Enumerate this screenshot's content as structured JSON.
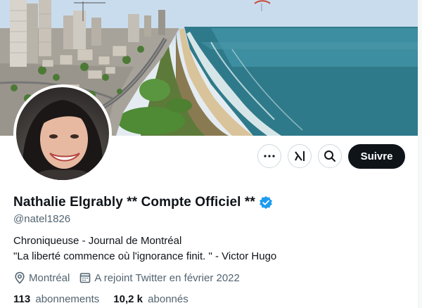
{
  "profile": {
    "display_name": "Nathalie Elgrably ** Compte Officiel **",
    "handle": "@natel1826",
    "bio_lines": [
      "Chroniqueuse - Journal de Montréal",
      "\"La liberté commence où l'ignorance finit. \" - Victor Hugo"
    ],
    "location": "Montréal",
    "joined": "A rejoint Twitter en février 2022",
    "following_count": "113",
    "following_label": "abonnements",
    "followers_count": "10,2 k",
    "followers_label": "abonnés",
    "verified": true
  },
  "actions": {
    "more_icon": "more-horizontal-icon",
    "grok_icon": "grok-icon",
    "search_icon": "search-icon",
    "follow_label": "Suivre"
  },
  "icons": {
    "location": "location-pin-icon",
    "calendar": "calendar-icon",
    "verified": "verified-badge-icon"
  },
  "colors": {
    "primary_text": "#0f1419",
    "secondary_text": "#536471",
    "verified_blue": "#1d9bf0",
    "follow_button_bg": "#0f1419"
  }
}
